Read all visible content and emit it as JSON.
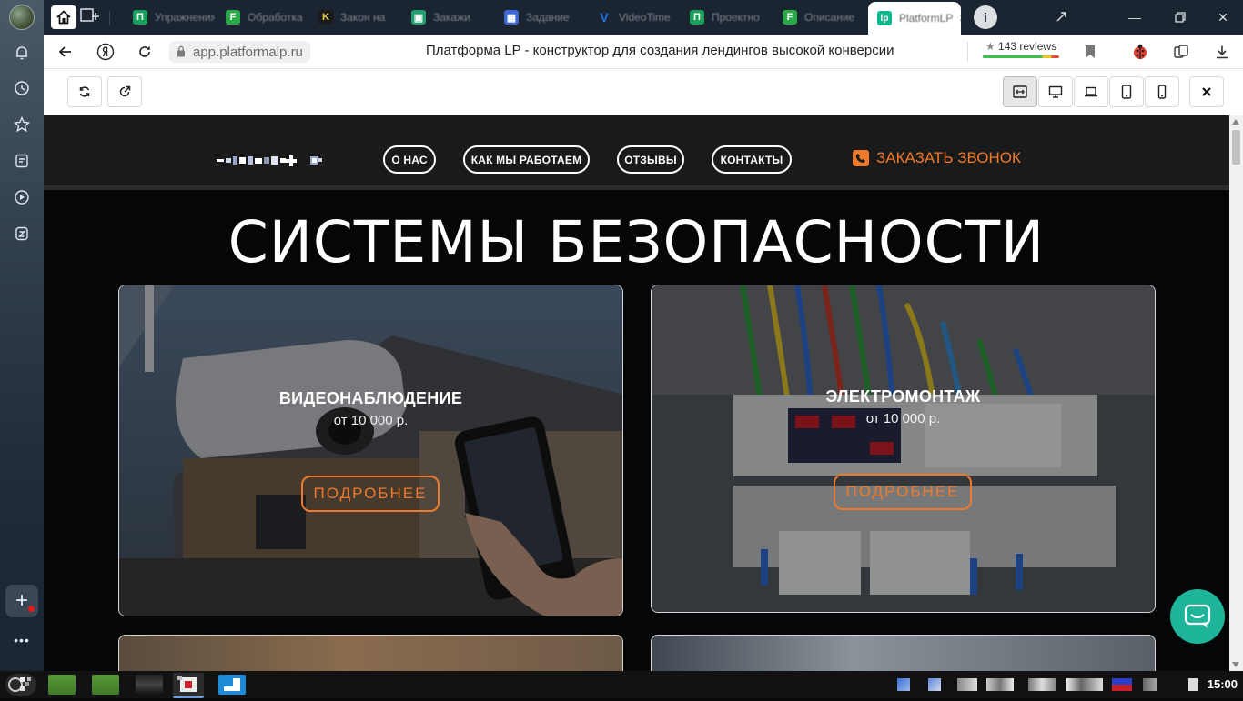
{
  "browser": {
    "tabs": [
      {
        "title": "Упражнения",
        "favicon_color": "#18a05a",
        "favicon_letter": "П"
      },
      {
        "title": "Обработка",
        "favicon_color": "#2aa84a",
        "favicon_letter": "F"
      },
      {
        "title": "Закон на",
        "favicon_color": "#1b1b1b",
        "favicon_letter": "K"
      },
      {
        "title": "Закажи",
        "favicon_color": "#20a070",
        "favicon_letter": "▣"
      },
      {
        "title": "Задание",
        "favicon_color": "#3a67d1",
        "favicon_letter": "▦"
      },
      {
        "title": "VideoTime",
        "favicon_color": "#1a73e8",
        "favicon_letter": "V"
      },
      {
        "title": "Проектно",
        "favicon_color": "#18a05a",
        "favicon_letter": "П"
      },
      {
        "title": "Описание",
        "favicon_color": "#2aa84a",
        "favicon_letter": "F"
      },
      {
        "title": "PlatformLP",
        "favicon_color": "#0fb68c",
        "favicon_letter": "lp",
        "active": true
      }
    ],
    "address": {
      "url": "app.platformalp.ru",
      "page_title": "Платформа LP - конструктор для создания лендингов высокой конверсии",
      "reviews": "143 reviews"
    }
  },
  "site": {
    "nav": [
      "О НАС",
      "КАК МЫ РАБОТАЕМ",
      "ОТЗЫВЫ",
      "КОНТАКТЫ"
    ],
    "callback": "ЗАКАЗАТЬ ЗВОНОК",
    "hero_title": "СИСТЕМЫ БЕЗОПАСНОСТИ",
    "cards": [
      {
        "name": "ВИДЕОНАБЛЮДЕНИЕ",
        "price": "от 10 000 р.",
        "button": "ПОДРОБНЕЕ"
      },
      {
        "name": "ЭЛЕКТРОМОНТАЖ",
        "price": "от 10 000 р.",
        "button": "ПОДРОБНЕЕ"
      }
    ],
    "accent_color": "#f07a2b"
  },
  "taskbar": {
    "clock": "15:00"
  }
}
